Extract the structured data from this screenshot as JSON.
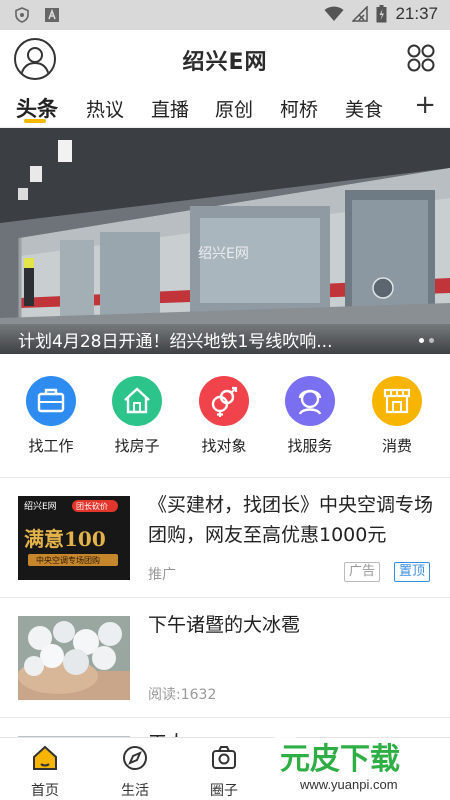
{
  "status_bar": {
    "time": "21:37"
  },
  "header": {
    "brand": "绍兴E网"
  },
  "tabs": [
    {
      "label": "头条",
      "active": true
    },
    {
      "label": "热议"
    },
    {
      "label": "直播"
    },
    {
      "label": "原创"
    },
    {
      "label": "柯桥"
    },
    {
      "label": "美食"
    }
  ],
  "tabs_more": "+",
  "banner": {
    "caption": "计划4月28日开通！绍兴地铁1号线吹响...",
    "watermark": "绍兴E网",
    "slides": 2,
    "active_slide": 1
  },
  "services": [
    {
      "label": "找工作",
      "icon": "briefcase-icon",
      "color": "#2e8cf0"
    },
    {
      "label": "找房子",
      "icon": "house-icon",
      "color": "#2cc48a"
    },
    {
      "label": "找对象",
      "icon": "gender-icon",
      "color": "#f0434b"
    },
    {
      "label": "找服务",
      "icon": "service-person-icon",
      "color": "#7a6ff0"
    },
    {
      "label": "消费",
      "icon": "shop-icon",
      "color": "#f7b500"
    }
  ],
  "news": [
    {
      "title": "《买建材，找团长》中央空调专场团购，网友至高优惠1000元",
      "meta": "推广",
      "tags": [
        "广告",
        "置顶"
      ],
      "thumb": {
        "brand": "绍兴E网",
        "badge": "团长砍价",
        "headline": "满意100",
        "sub": "中央空调专场团购"
      }
    },
    {
      "title": "下午诸暨的大冰雹",
      "meta": "阅读:1632"
    },
    {
      "title": "工人……",
      "meta": ""
    }
  ],
  "bottom_nav": [
    {
      "label": "首页",
      "icon": "home-icon",
      "active": true
    },
    {
      "label": "生活",
      "icon": "compass-icon"
    },
    {
      "label": "圈子",
      "icon": "camera-icon"
    }
  ],
  "watermark": {
    "brand": "元皮下载",
    "url": "www.yuanpi.com"
  },
  "colors": {
    "accent": "#f5b800",
    "tag_ad": "#999999",
    "tag_top": "#3a8ee6"
  }
}
